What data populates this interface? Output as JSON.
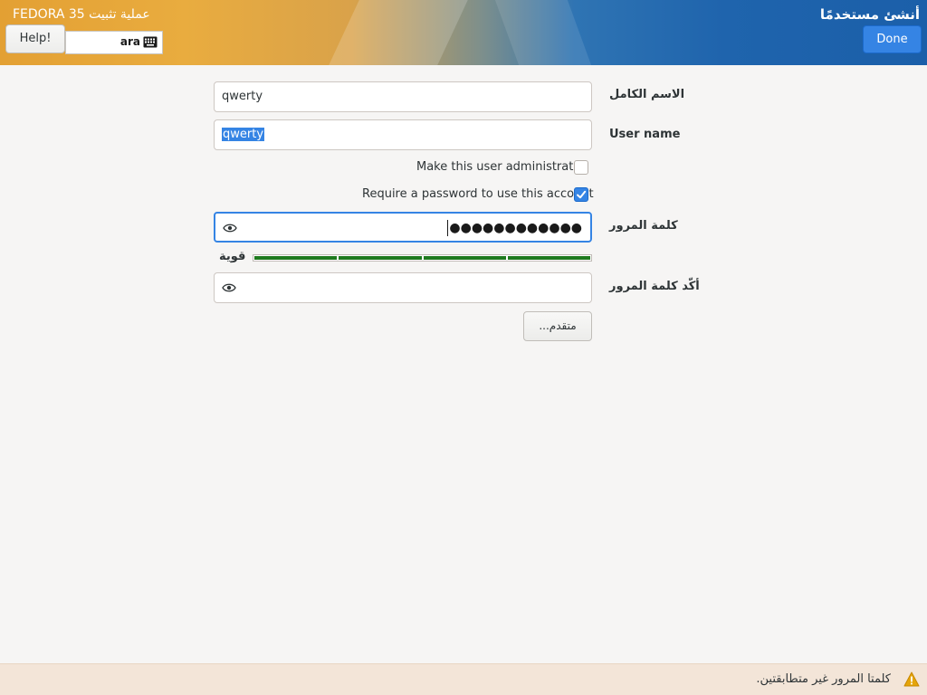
{
  "header": {
    "screen_title": "أنشئ مستخدمًا",
    "product_title": "عملية تثبيت FEDORA 35",
    "done_label": "Done",
    "help_label": "Help!",
    "keyboard_layout": "ara"
  },
  "form": {
    "full_name_label": "الاسم الكامل",
    "full_name_value": "qwerty",
    "username_label": "User name",
    "username_value": "qwerty",
    "admin_checkbox_label": "Make this user administrator",
    "admin_checked": false,
    "require_password_label": "Require a password to use this account",
    "require_password_checked": true,
    "password_label": "كلمة المرور",
    "password_masked": "●●●●●●●●●●●●",
    "strength_label": "قوية",
    "strength_level": 4,
    "strength_max": 4,
    "confirm_password_label": "أكّد كلمة المرور",
    "confirm_password_value": "",
    "advanced_label": "متقدم..."
  },
  "status": {
    "message": "كلمتا المرور غير متطابقتين.",
    "icon": "warning-icon"
  },
  "colors": {
    "accent": "#3584e4",
    "strength": "#1e7a1e",
    "warning": "#e5a50a"
  }
}
